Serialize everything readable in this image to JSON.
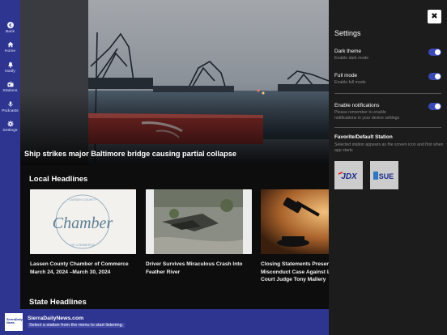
{
  "nav": {
    "items": [
      {
        "label": "Back",
        "icon": "back-icon"
      },
      {
        "label": "Home",
        "icon": "home-icon"
      },
      {
        "label": "Notify",
        "icon": "bell-icon"
      },
      {
        "label": "Stations",
        "icon": "radio-icon"
      },
      {
        "label": "Podcasts",
        "icon": "microphone-icon"
      },
      {
        "label": "Settings",
        "icon": "gear-icon"
      }
    ]
  },
  "hero": {
    "headline": "Ship strikes major Baltimore bridge causing partial collapse"
  },
  "local": {
    "title": "Local Headlines",
    "cards": [
      {
        "line1": "Lassen County Chamber of Commerce",
        "line2": "March 24, 2024 –March 30, 2024",
        "thumb_word": "Chamber",
        "thumb_top": "LASSEN COUNTY",
        "thumb_bottom": "OF COMMERCE"
      },
      {
        "line1": "Driver Survives Miraculous Crash Into",
        "line2": "Feather River"
      },
      {
        "line1": "Closing Statements Presen",
        "line2": "Misconduct Case Against L",
        "line3": "Court Judge Tony Mallery"
      }
    ]
  },
  "state": {
    "title": "State Headlines"
  },
  "player": {
    "station_name": "SierraDailyNews.com",
    "status": "Select a station from the menu to start listening.",
    "logo_text": "SierraDaily News"
  },
  "settings": {
    "title": "Settings",
    "close_label": "✖",
    "dark_theme": {
      "label": "Dark theme",
      "desc": "Enable dark mode",
      "on": true
    },
    "full_mode": {
      "label": "Full mode",
      "desc": "Enable full mode",
      "on": true
    },
    "notifications": {
      "label": "Enable notifications",
      "desc1": "Please remember to enable",
      "desc2": "notifications in your device settings",
      "on": true
    },
    "favorite": {
      "title": "Favorite/Default Station",
      "desc": "Selected station appears as the screen icon and first when app starts",
      "stations": [
        {
          "name": "JDX"
        },
        {
          "name": "SUE"
        }
      ]
    }
  },
  "colors": {
    "brand_blue": "#2d3590",
    "toggle_on": "#3b48b8",
    "panel_bg": "#1c1c1c"
  }
}
